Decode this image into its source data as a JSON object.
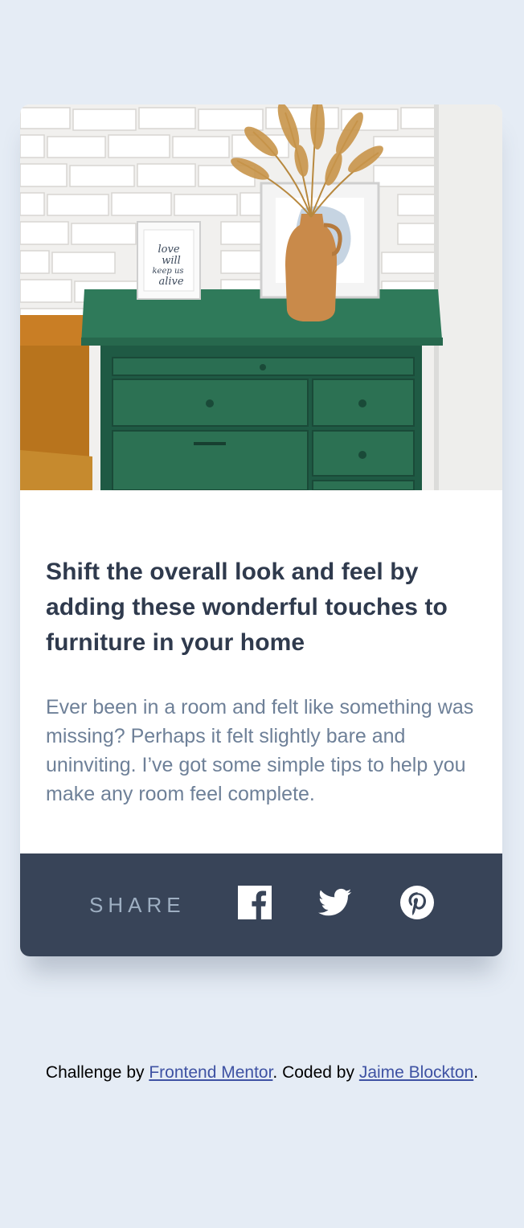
{
  "article": {
    "hero_image_alt": "Green drawers with vase and frames",
    "frame_text": "love will keep us alive",
    "title": "Shift the overall look and feel by adding these wonderful touches to furniture in your home",
    "description": "Ever been in a room and felt like something was missing? Perhaps it felt slightly bare and uninviting. I’ve got some simple tips to help you make any room feel complete."
  },
  "share": {
    "label": "SHARE",
    "icons": [
      "facebook-icon",
      "twitter-icon",
      "pinterest-icon"
    ]
  },
  "footer": {
    "prefix": "Challenge by ",
    "link1": "Frontend Mentor",
    "middle": ". Coded by ",
    "link2": "Jaime Blockton",
    "suffix": "."
  },
  "colors": {
    "background": "#e5ecf5",
    "title": "#2f3a4d",
    "body_text": "#6e8098",
    "share_bar": "#384458",
    "share_label": "#9eafc2",
    "link": "#3e52a3"
  }
}
